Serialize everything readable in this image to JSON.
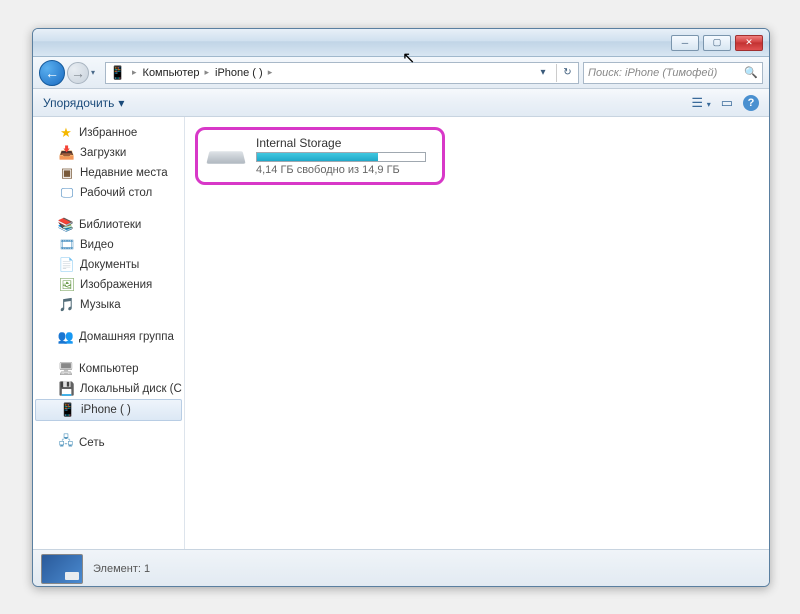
{
  "window": {
    "minimize": "─",
    "maximize": "▢",
    "close": "✕"
  },
  "nav": {
    "back_arrow": "←",
    "fwd_arrow": "→",
    "drop": "▾",
    "refresh": "↻"
  },
  "breadcrumbs": [
    {
      "label": "Компьютер"
    },
    {
      "label": "iPhone (            )"
    }
  ],
  "search": {
    "placeholder": "Поиск: iPhone (Тимофей)",
    "icon": "🔍"
  },
  "toolbar": {
    "organize": "Упорядочить",
    "drop": "▾",
    "view_icon": "☰",
    "preview_icon": "▭",
    "help_icon": "?"
  },
  "sidebar": {
    "favorites": {
      "label": "Избранное",
      "items": [
        {
          "icon": "folder-dl",
          "glyph": "📥",
          "label": "Загрузки"
        },
        {
          "icon": "recent",
          "glyph": "▣",
          "label": "Недавние места"
        },
        {
          "icon": "desktop",
          "glyph": "🖵",
          "label": "Рабочий стол"
        }
      ]
    },
    "libraries": {
      "label": "Библиотеки",
      "items": [
        {
          "icon": "video",
          "glyph": "🎞",
          "label": "Видео"
        },
        {
          "icon": "doc",
          "glyph": "📄",
          "label": "Документы"
        },
        {
          "icon": "img",
          "glyph": "🖼",
          "label": "Изображения"
        },
        {
          "icon": "music",
          "glyph": "🎵",
          "label": "Музыка"
        }
      ]
    },
    "homegroup": {
      "label": "Домашняя группа"
    },
    "computer": {
      "label": "Компьютер",
      "items": [
        {
          "icon": "disk",
          "glyph": "💾",
          "label": "Локальный диск (C"
        },
        {
          "icon": "phone",
          "glyph": "📱",
          "label": "iPhone (            )",
          "selected": true
        }
      ]
    },
    "network": {
      "label": "Сеть"
    }
  },
  "content": {
    "storage": {
      "title": "Internal Storage",
      "fill_percent": 72,
      "subtitle": "4,14 ГБ свободно из 14,9 ГБ"
    }
  },
  "statusbar": {
    "text": "Элемент: 1"
  }
}
